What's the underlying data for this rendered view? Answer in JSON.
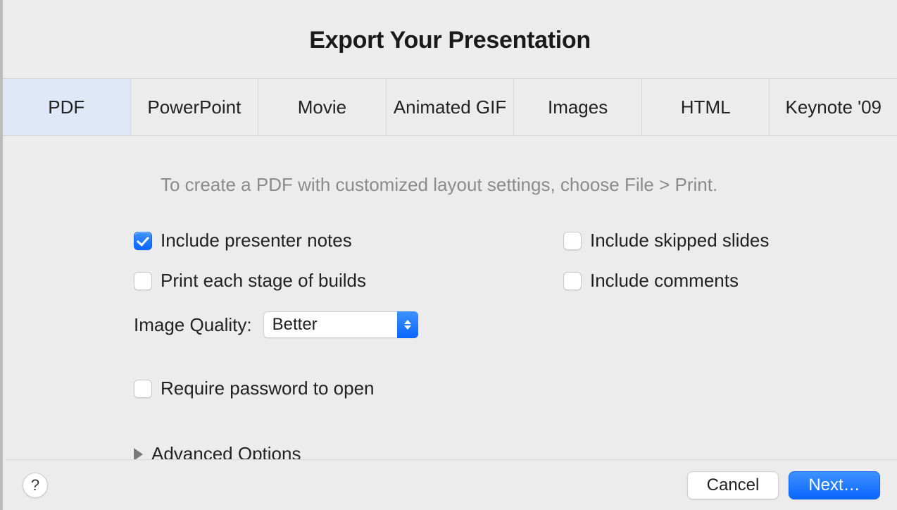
{
  "title": "Export Your Presentation",
  "tabs": [
    "PDF",
    "PowerPoint",
    "Movie",
    "Animated GIF",
    "Images",
    "HTML",
    "Keynote '09"
  ],
  "selected_tab_index": 0,
  "hint": "To create a PDF with customized layout settings, choose File > Print.",
  "options": {
    "include_presenter_notes": {
      "label": "Include presenter notes",
      "checked": true
    },
    "include_skipped_slides": {
      "label": "Include skipped slides",
      "checked": false
    },
    "print_each_stage": {
      "label": "Print each stage of builds",
      "checked": false
    },
    "include_comments": {
      "label": "Include comments",
      "checked": false
    },
    "require_password": {
      "label": "Require password to open",
      "checked": false
    }
  },
  "image_quality": {
    "label": "Image Quality:",
    "value": "Better"
  },
  "advanced_label": "Advanced Options",
  "help_symbol": "?",
  "buttons": {
    "cancel": "Cancel",
    "next": "Next…"
  }
}
